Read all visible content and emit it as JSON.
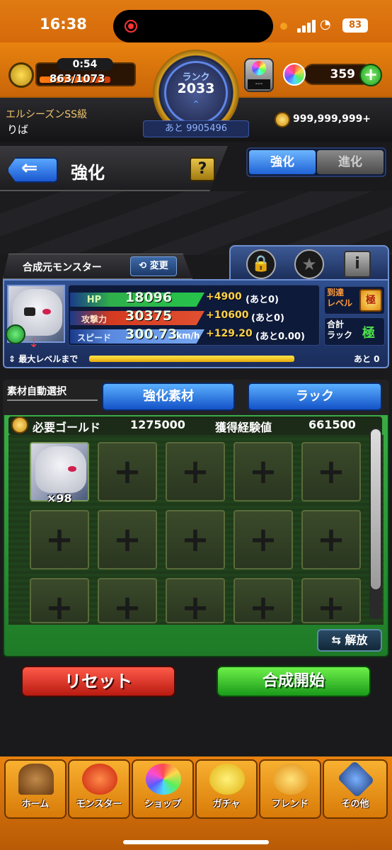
{
  "status_bar": {
    "time": "16:38",
    "battery": "83"
  },
  "header": {
    "stamina_timer": "0:54",
    "stamina_value": "863/1073",
    "rank_label": "ランク",
    "rank_value": "2033",
    "rank_next": "あと 9905496",
    "orb_box_value": "---",
    "orbs": "359",
    "user_title": "エルシーズンSS級",
    "user_name": "りば",
    "gold": "999,999,999+"
  },
  "title_bar": {
    "title": "強化",
    "help": "?",
    "tabs": [
      {
        "label": "強化",
        "active": true
      },
      {
        "label": "進化",
        "active": false
      }
    ]
  },
  "base_monster": {
    "tab_label": "合成元モンスター",
    "change_label": "変更",
    "stats": [
      {
        "label": "HP",
        "value": "18096",
        "plus": "+4900",
        "rest": "(あと0)"
      },
      {
        "label": "攻撃力",
        "value": "30375",
        "plus": "+10600",
        "rest": "(あと0)"
      },
      {
        "label": "スピード",
        "value": "300.73",
        "unit": "km/h",
        "plus": "+129.20",
        "rest": "(あと0.00)"
      }
    ],
    "reach_level_label": "到達\nレベル",
    "reach_level_badge": "極",
    "luck_label": "合計\nラック",
    "luck_value": "極",
    "max_level_label": "最大レベルまで",
    "max_level_rest": "あと 0"
  },
  "material": {
    "auto_select_label": "素材自動選択",
    "tabs": [
      "強化素材",
      "ラック"
    ],
    "gold_label": "必要ゴールド",
    "gold_value": "1275000",
    "exp_label": "獲得経験値",
    "exp_value": "661500",
    "first_slot_count": "×98",
    "release_label": "解放"
  },
  "actions": {
    "reset": "リセット",
    "start": "合成開始"
  },
  "nav": [
    "ホーム",
    "モンスター",
    "ショップ",
    "ガチャ",
    "フレンド",
    "その他"
  ],
  "colors": {
    "accent_orange": "#e8820f",
    "blue_button": "#1f62d6",
    "green_panel": "#2e9a3a",
    "red_button": "#d0281a"
  }
}
